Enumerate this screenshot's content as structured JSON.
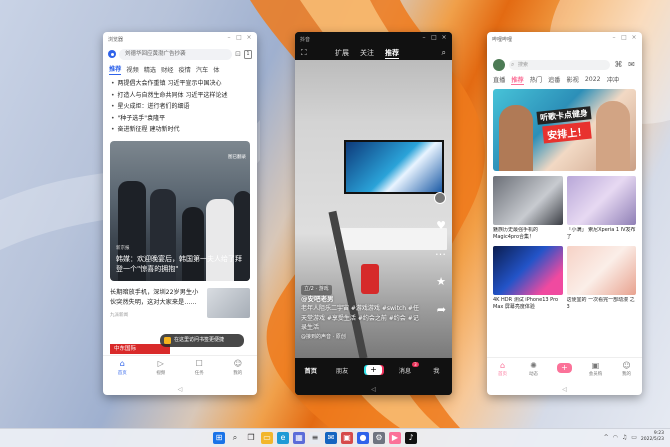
{
  "news_app": {
    "window_title": "浏览器",
    "search_placeholder": "刘德华回应黄渤广告抄袭",
    "tool_badge": "1",
    "categories": [
      "推荐",
      "视频",
      "精选",
      "财经",
      "疫情",
      "汽车",
      "体"
    ],
    "hot_list": [
      "两提倡大会作重镇 习近平宣示中国决心",
      "打造人与自然生命共同体 习近平这样论述",
      "星火成炬：迸行者们的细语",
      "\"种子选手\"袁隆平",
      "奋进新征程 建功新时代"
    ],
    "hero_tag": "图已翻录",
    "hero_source": "新京报",
    "hero_caption": "韩媒：欢迎晚宴后，韩国第一夫人给了拜登一个\"惊喜的拥抱\"",
    "second_title": "长期暗放手机，深圳22岁男生小伙突然失明，这对大家来是……",
    "second_source": "九派新闻",
    "toast_text": "在这里访问书签更便捷",
    "red_banner": "中东国际",
    "tabs": [
      "首页",
      "视频",
      "任务",
      "我的"
    ]
  },
  "video_app": {
    "window_title": "抖音",
    "top_tabs": [
      "扩展",
      "关注",
      "推荐"
    ],
    "follow_badge": "",
    "location_tag": "立/2 · 游戏",
    "author": "@安吧老男",
    "description": "老年人阻乐二宇宙 #游戏游戏 #switch #任天堂游戏 #享受生活 #约会之前 #约会 #记录生活",
    "music": "@接到的声音 · 原创",
    "side_counts": [
      "",
      "",
      "",
      ""
    ],
    "tabs": [
      "首页",
      "朋友",
      "+",
      "消息",
      "我"
    ],
    "message_badge": "3"
  },
  "bili_app": {
    "window_title": "哔哩哔哩",
    "status_left": "",
    "status_right": "",
    "search_placeholder": "搜索",
    "nav": [
      "直播",
      "推荐",
      "热门",
      "追番",
      "影视",
      "2022",
      "冲冲"
    ],
    "banner_line1": "听歌卡点健身",
    "banner_line2": "安排上！",
    "cards": [
      {
        "title": "魅族历史最强手机的Magic4pro合集！",
        "meta": ""
      },
      {
        "title": "「小满」 索尼Xperia 1 IV发布了",
        "meta": ""
      },
      {
        "title": "4K HDR 测试 iPhone13 Pro Max 屏幕亮度体验",
        "meta": ""
      },
      {
        "title": "这便宜的 一次看完一部动漫 之3",
        "meta": ""
      }
    ],
    "tabs": [
      "首页",
      "动态",
      "+",
      "会员购",
      "我的"
    ]
  },
  "taskbar": {
    "time": "9:23",
    "date": "2022/5/23"
  },
  "colors": {
    "news_accent": "#2f63ea",
    "video_badge": "#e8335a",
    "bili_pink": "#fb7299"
  }
}
